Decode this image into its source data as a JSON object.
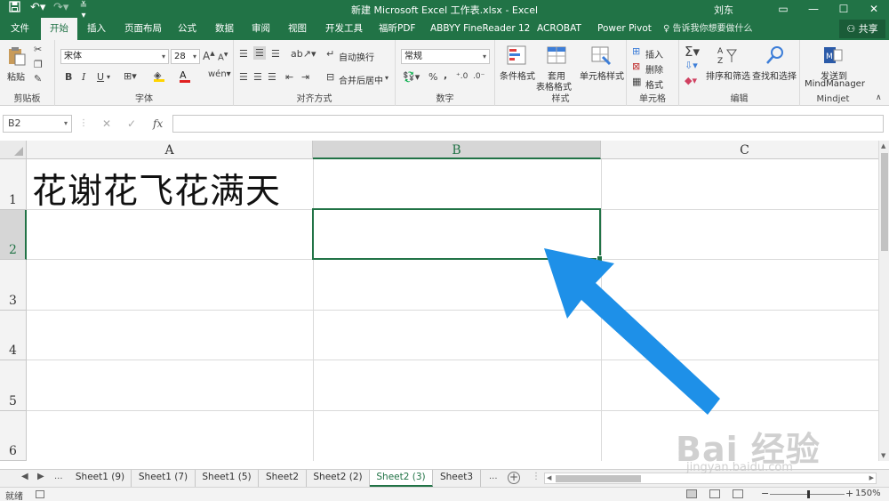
{
  "app": {
    "title": "新建 Microsoft Excel 工作表.xlsx  -  Excel",
    "user": "刘东",
    "quick_access": [
      "save-icon",
      "undo-icon",
      "redo-icon",
      "customize-icon"
    ]
  },
  "colors": {
    "accent": "#217346",
    "arrow": "#1e90e8"
  },
  "ribbon_tabs": [
    {
      "label": "文件",
      "active": false
    },
    {
      "label": "开始",
      "active": true
    },
    {
      "label": "插入",
      "active": false
    },
    {
      "label": "页面布局",
      "active": false
    },
    {
      "label": "公式",
      "active": false
    },
    {
      "label": "数据",
      "active": false
    },
    {
      "label": "审阅",
      "active": false
    },
    {
      "label": "视图",
      "active": false
    },
    {
      "label": "开发工具",
      "active": false
    },
    {
      "label": "福昕PDF",
      "active": false
    },
    {
      "label": "ABBYY FineReader 12",
      "active": false
    },
    {
      "label": "ACROBAT",
      "active": false
    },
    {
      "label": "Power Pivot",
      "active": false
    }
  ],
  "tell_me": "告诉我你想要做什么",
  "share": "共享",
  "ribbon": {
    "clipboard": {
      "label": "剪贴板",
      "paste": "粘贴"
    },
    "font": {
      "label": "字体",
      "name": "宋体",
      "size": "28",
      "bold": "B",
      "italic": "I",
      "underline": "U",
      "grow": "A",
      "shrink": "A",
      "color_letter": "A"
    },
    "alignment": {
      "label": "对齐方式",
      "wrap": "自动换行",
      "merge": "合并后居中"
    },
    "number": {
      "label": "数字",
      "format": "常规",
      "percent": "%",
      "comma": ","
    },
    "styles": {
      "label": "样式",
      "conditional": "条件格式",
      "table_line1": "套用",
      "table_line2": "表格格式",
      "cell_styles": "单元格样式"
    },
    "cells": {
      "label": "单元格",
      "insert": "插入",
      "delete": "删除",
      "format": "格式"
    },
    "editing": {
      "label": "编辑",
      "sort": "排序和筛选",
      "find": "查找和选择"
    },
    "mindjet": {
      "label": "Mindjet",
      "send_line1": "发送到",
      "send_line2": "MindManager"
    }
  },
  "formula_bar": {
    "name_box": "B2",
    "cancel": "✕",
    "enter": "✓",
    "fx": "fx",
    "value": ""
  },
  "sheet": {
    "columns": [
      "A",
      "B",
      "C"
    ],
    "rows": [
      "1",
      "2",
      "3",
      "4",
      "5",
      "6"
    ],
    "selected_cell": "B2",
    "cells": {
      "A1": "花谢花飞花满天"
    }
  },
  "sheet_tabs": [
    {
      "label": "Sheet1 (9)",
      "active": false
    },
    {
      "label": "Sheet1 (7)",
      "active": false
    },
    {
      "label": "Sheet1 (5)",
      "active": false
    },
    {
      "label": "Sheet2",
      "active": false
    },
    {
      "label": "Sheet2 (2)",
      "active": false
    },
    {
      "label": "Sheet2 (3)",
      "active": true
    },
    {
      "label": "Sheet3",
      "active": false
    }
  ],
  "sheet_nav": {
    "more": "..."
  },
  "status": {
    "ready": "就绪",
    "zoom": "150%",
    "zoom_minus": "−",
    "zoom_plus": "+"
  },
  "watermark": {
    "brand": "Bai 经验",
    "url": "jingyan.baidu.com"
  }
}
